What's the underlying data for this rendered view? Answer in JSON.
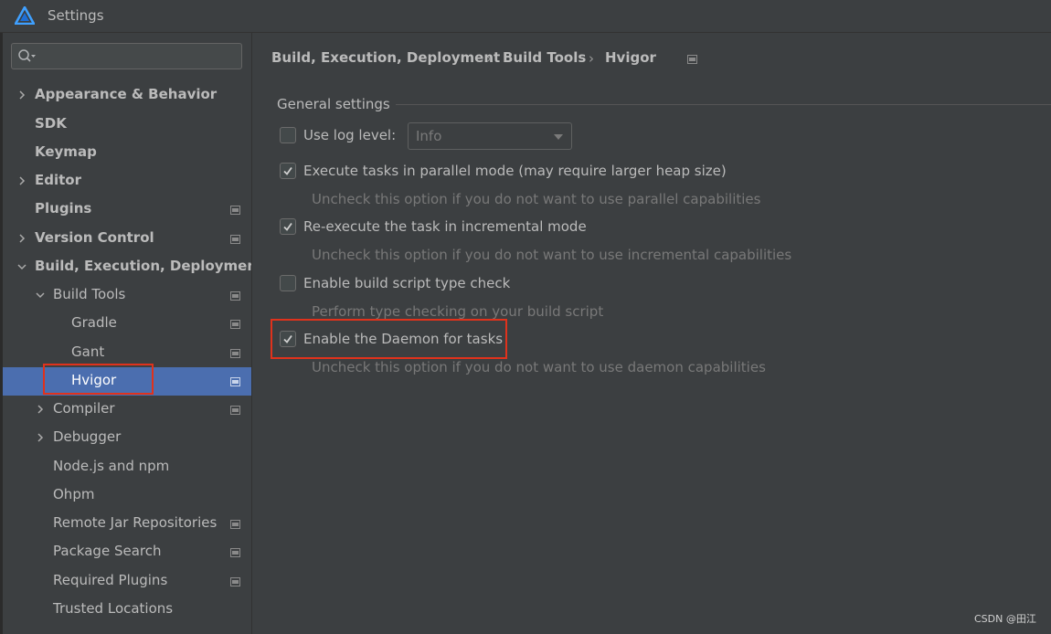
{
  "window": {
    "title": "Settings",
    "logo_icon": "harmony-logo-icon"
  },
  "search": {
    "placeholder": "",
    "value": ""
  },
  "sidebar": {
    "items": [
      {
        "label": "Appearance & Behavior"
      },
      {
        "label": "SDK"
      },
      {
        "label": "Keymap"
      },
      {
        "label": "Editor"
      },
      {
        "label": "Plugins"
      },
      {
        "label": "Version Control"
      },
      {
        "label": "Build, Execution, Deployment"
      },
      {
        "label": "Build Tools"
      },
      {
        "label": "Gradle"
      },
      {
        "label": "Gant"
      },
      {
        "label": "Hvigor"
      },
      {
        "label": "Compiler"
      },
      {
        "label": "Debugger"
      },
      {
        "label": "Node.js and npm"
      },
      {
        "label": "Ohpm"
      },
      {
        "label": "Remote Jar Repositories"
      },
      {
        "label": "Package Search"
      },
      {
        "label": "Required Plugins"
      },
      {
        "label": "Trusted Locations"
      }
    ],
    "selected": "Hvigor"
  },
  "breadcrumb": {
    "items": [
      "Build, Execution, Deployment",
      "Build Tools",
      "Hvigor"
    ],
    "separator": "›"
  },
  "general_settings": {
    "title": "General settings",
    "log_level": {
      "label": "Use log level:",
      "checked": false,
      "value": "Info"
    },
    "parallel": {
      "label": "Execute tasks in parallel mode (may require larger heap size)",
      "checked": true,
      "hint": "Uncheck this option if you do not want to use parallel capabilities"
    },
    "incremental": {
      "label": "Re-execute the task in incremental mode",
      "checked": true,
      "hint": "Uncheck this option if you do not want to use incremental capabilities"
    },
    "type_check": {
      "label": "Enable build script type check",
      "checked": false,
      "hint": "Perform type checking on your build script"
    },
    "daemon": {
      "label": "Enable the Daemon for tasks",
      "checked": true,
      "hint": "Uncheck this option if you do not want to use daemon capabilities"
    }
  },
  "colors": {
    "background": "#3c3f41",
    "selection": "#4b6eaf",
    "highlight_box": "#e0321c",
    "text": "#bbbbbb",
    "hint_text": "#787878"
  },
  "watermark": "CSDN @田江"
}
